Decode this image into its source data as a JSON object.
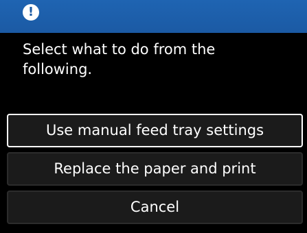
{
  "header": {
    "icon": "exclamation-icon",
    "icon_glyph": "!",
    "accent_color": "#1b5aa4"
  },
  "message": {
    "line1": "Select what to do from the",
    "line2": "following."
  },
  "options": [
    {
      "label": "Use manual feed tray settings",
      "selected": true
    },
    {
      "label": "Replace the paper and print",
      "selected": false
    },
    {
      "label": "Cancel",
      "selected": false
    }
  ]
}
